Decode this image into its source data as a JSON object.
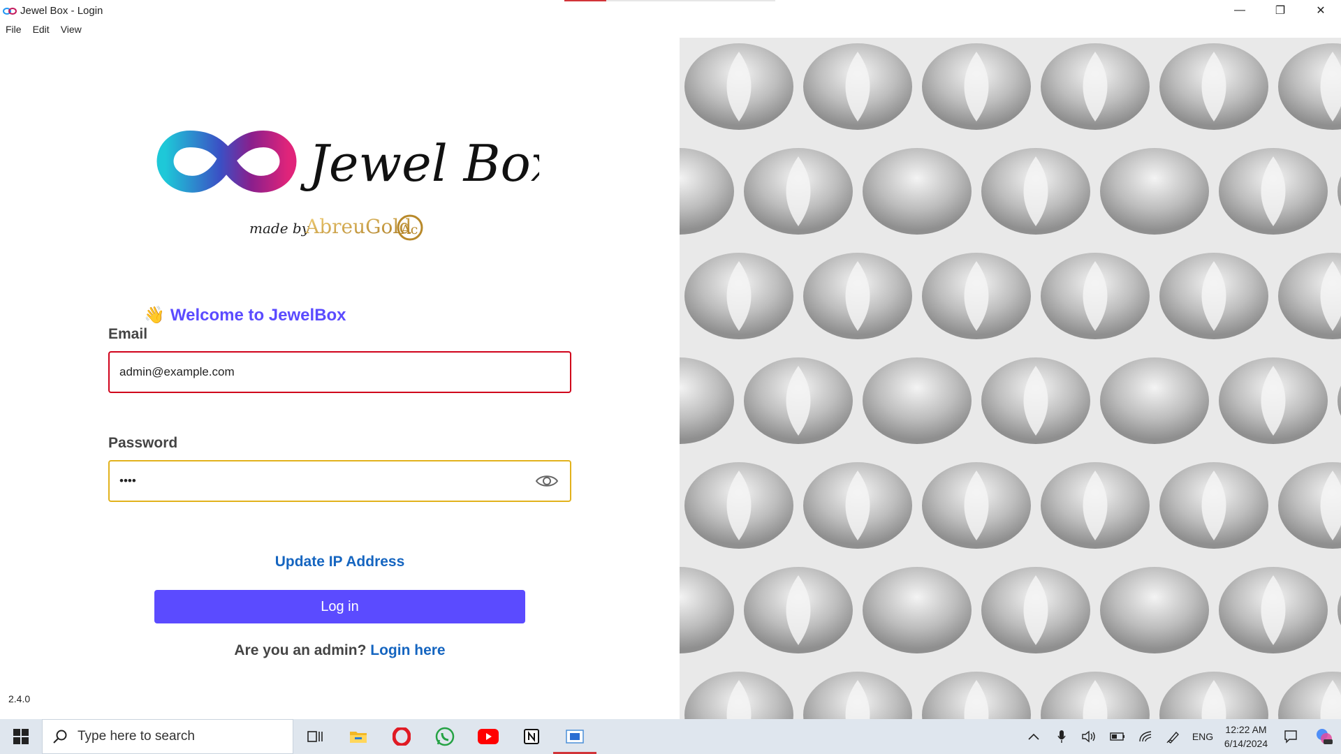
{
  "window": {
    "title": "Jewel Box - Login",
    "title_progress_fraction": 0.2,
    "controls": {
      "minimize": "—",
      "restore": "❐",
      "close": "✕"
    }
  },
  "menu": [
    "File",
    "Edit",
    "View"
  ],
  "logo": {
    "brand": "Jewel Box",
    "made_by": "made by",
    "maker": "AbreuGold",
    "maker_mark": "Ac"
  },
  "welcome": {
    "emoji": "👋",
    "text": "Welcome to JewelBox"
  },
  "form": {
    "email_label": "Email",
    "email_value": "admin@example.com",
    "password_label": "Password",
    "password_value": "••••",
    "update_link": "Update IP Address",
    "login_button": "Log in",
    "admin_prompt": "Are you an admin?",
    "admin_link": "Login here"
  },
  "version": "2.4.0",
  "taskbar": {
    "search_placeholder": "Type here to search",
    "apps": [
      "task-view",
      "file-explorer",
      "opera",
      "whatsapp",
      "youtube",
      "notion",
      "jewel-box"
    ],
    "tray": {
      "language": "ENG",
      "time": "12:22 AM",
      "date": "6/14/2024"
    }
  },
  "colors": {
    "accent": "#5b4bff",
    "link": "#1565c0",
    "email_border": "#d0021b",
    "password_border": "#e2b21c"
  }
}
